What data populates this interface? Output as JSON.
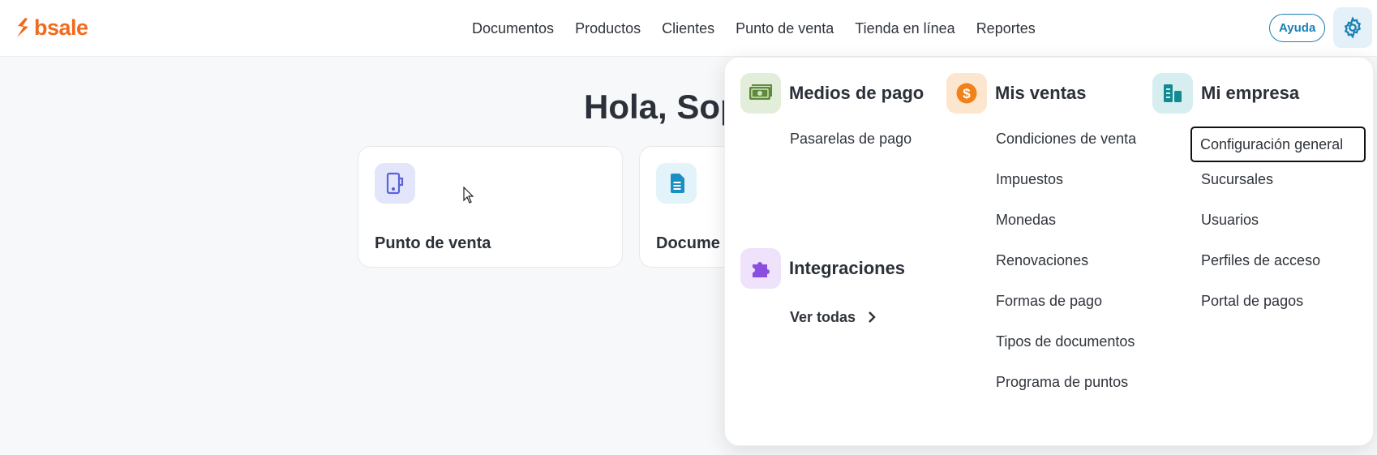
{
  "brand": {
    "name": "bsale",
    "color": "#f26a1b"
  },
  "nav": {
    "items": [
      "Documentos",
      "Productos",
      "Clientes",
      "Punto de venta",
      "Tienda en línea",
      "Reportes"
    ]
  },
  "header": {
    "help_label": "Ayuda",
    "settings_icon": "gear-icon",
    "accent": "#1a7fb3"
  },
  "main": {
    "greeting": "Hola, Sop",
    "cards": [
      {
        "title": "Punto de venta",
        "icon": "pos-tablet-icon"
      },
      {
        "title": "Docume",
        "icon": "document-icon"
      }
    ]
  },
  "settings_menu": {
    "medios_de_pago": {
      "title": "Medios de pago",
      "icon": "cash-icon",
      "links": [
        "Pasarelas de pago"
      ]
    },
    "integraciones": {
      "title": "Integraciones",
      "icon": "puzzle-icon",
      "see_all": "Ver todas"
    },
    "mis_ventas": {
      "title": "Mis ventas",
      "icon": "dollar-coin-icon",
      "links": [
        "Condiciones de venta",
        "Impuestos",
        "Monedas",
        "Renovaciones",
        "Formas de pago",
        "Tipos de documentos",
        "Programa de puntos"
      ]
    },
    "mi_empresa": {
      "title": "Mi empresa",
      "icon": "building-icon",
      "links": [
        "Configuración general",
        "Sucursales",
        "Usuarios",
        "Perfiles de acceso",
        "Portal de pagos"
      ],
      "focused_index": 0
    }
  }
}
